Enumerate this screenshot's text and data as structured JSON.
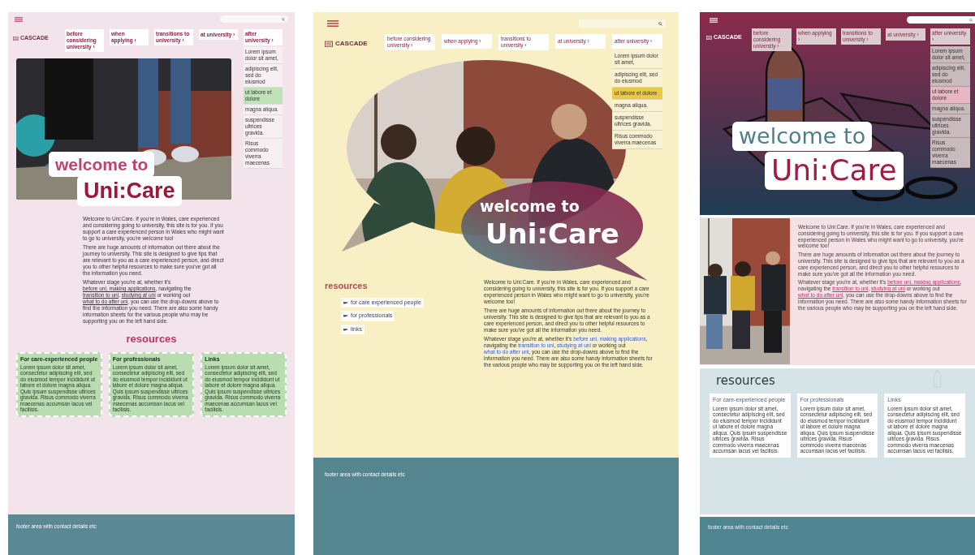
{
  "panels": [
    {
      "kind": "pink",
      "logo": "CASCADE",
      "nav": [
        "before considering university ›",
        "when applying ›",
        "transitions to university ›",
        "at university ›",
        "after university ›"
      ],
      "dropdown": [
        {
          "label": "Lorem ipsum dolor sit amet,",
          "selected": false
        },
        {
          "label": "adipiscing elit, sed do eiusmod",
          "selected": false
        },
        {
          "label": "ut labore et dolore",
          "selected": true
        },
        {
          "label": "magna aliqua.",
          "selected": false
        },
        {
          "label": "suspendisse ultrices gravida.",
          "selected": false
        },
        {
          "label": "Risus commodo viverra maecenas",
          "selected": false
        }
      ],
      "hero": {
        "line1": "welcome to",
        "line2": "Uni:Care"
      },
      "paragraphs": [
        [
          {
            "text": "Welcome to Uni:Care. If you're in Wales, care experienced and considering going to university, this site is for you. If you support a care experienced person in Wales who might want to go to university, you're welcome too!"
          }
        ],
        [
          {
            "text": "There are huge amounts of information out there about the journey to university. This site is designed to give tips that are relevant to you as a care experienced person, and direct you to other helpful resources to make sure you've got all the information you need."
          }
        ],
        [
          {
            "text": "Whatever stage you're at, whether it's "
          },
          {
            "text": "before uni, making applications",
            "link": true
          },
          {
            "text": ", navigating the "
          },
          {
            "text": "transition to uni",
            "link": true
          },
          {
            "text": ", "
          },
          {
            "text": "studying at uni",
            "link": true
          },
          {
            "text": " or working out "
          },
          {
            "text": "what to do after uni",
            "link": true
          },
          {
            "text": ", you can use the drop-downs above to find the information you need. There are also some handy information sheets for the various people who may be supporting you on the left hand side."
          }
        ]
      ],
      "resources": {
        "heading": "resources",
        "items": [
          {
            "title": "For care-experienced people",
            "body": "Lorem ipsum dolor sit amet, consectetur adipiscing elit, sed do eiusmod tempor incididunt ut labore et dolore magna aliqua. Quis ipsum suspendisse ultrices gravida. Risus commodo viverra maecenas accumsan lacus vel facilisis."
          },
          {
            "title": "For professionals",
            "body": "Lorem ipsum dolor sit amet, consectetur adipiscing elit, sed do eiusmod tempor incididunt ut labore et dolore magna aliqua. Quis ipsum suspendisse ultrices gravida. Risus commodo viverra maecenas accumsan lacus vel facilisis."
          },
          {
            "title": "Links",
            "body": "Lorem ipsum dolor sit amet, consectetur adipiscing elit, sed do eiusmod tempor incididunt ut labore et dolore magna aliqua. Quis ipsum suspendisse ultrices gravida. Risus commodo viverra maecenas accumsan lacus vel facilisis."
          }
        ]
      },
      "footer": "footer area with contact details etc"
    },
    {
      "kind": "cream",
      "logo": "CASCADE",
      "nav": [
        "before considering university ›",
        "when applying ›",
        "transitions to university ›",
        "at university ›",
        "after university ›"
      ],
      "dropdown": [
        {
          "label": "Lorem ipsum dolor sit amet,",
          "selected": false
        },
        {
          "label": "adipiscing elit, sed do eiusmod",
          "selected": false
        },
        {
          "label": "ut labore et dolore",
          "selected": true
        },
        {
          "label": "magna aliqua.",
          "selected": false
        },
        {
          "label": "suspendisse ultrices gravida.",
          "selected": false
        },
        {
          "label": "Risus commodo viverra maecenas",
          "selected": false
        }
      ],
      "hero": {
        "line1": "welcome to",
        "line2": "Uni:Care"
      },
      "resources": {
        "heading": "resources",
        "items": [
          {
            "title": "for care experienced people"
          },
          {
            "title": "for professionals"
          },
          {
            "title": "links"
          }
        ]
      },
      "paragraphs": [
        [
          {
            "text": "Welcome to Uni:Care. If you're in Wales, care experienced and considering going to university, this site is for you. If you support a care experienced person in Wales who might want to go to university, you're welcome too!"
          }
        ],
        [
          {
            "text": "There are huge amounts of information out there about the journey to university. This site is designed to give tips that are relevant to you as a care experienced person, and direct you to other helpful resources to make sure you've got all the information you need."
          }
        ],
        [
          {
            "text": "Whatever stage you're at, whether it's "
          },
          {
            "text": "before uni, making applications",
            "link": true
          },
          {
            "text": ", navigating the "
          },
          {
            "text": "transition to uni",
            "link": true
          },
          {
            "text": ", "
          },
          {
            "text": "studying at uni",
            "link": true
          },
          {
            "text": " or working out "
          },
          {
            "text": "what to do after uni",
            "link": true
          },
          {
            "text": ", you can use the drop-downs above to find the information you need. There are also some handy information sheets for the various people who may be supporting you on the left hand side."
          }
        ]
      ],
      "footer": "footer area with contact details etc"
    },
    {
      "kind": "dark",
      "logo": "CASCADE",
      "nav": [
        "before considering university ›",
        "when applying ›",
        "transitions to university ›",
        "at university ›",
        "after university ›"
      ],
      "dropdown": [
        {
          "label": "Lorem ipsum dolor sit amet,",
          "selected": false
        },
        {
          "label": "adipiscing elit, sed do eiusmod",
          "selected": false
        },
        {
          "label": "ut labore et dolore",
          "selected": true
        },
        {
          "label": "magna aliqua.",
          "selected": false
        },
        {
          "label": "suspendisse ultrices gravida.",
          "selected": false
        },
        {
          "label": "Risus commodo viverra maecenas",
          "selected": false
        }
      ],
      "hero": {
        "line1": "welcome to",
        "line2": "Uni:Care"
      },
      "paragraphs": [
        [
          {
            "text": "Welcome to Uni:Care. If you're in Wales, care experienced and considering going to university, this site is for you. If you support a care experienced person in Wales who might want to go to university, you're welcome too!"
          }
        ],
        [
          {
            "text": "There are huge amounts of information out there about the journey to university. This site is designed to give tips that are relevant to you as a care experienced person, and direct you to other helpful resources to make sure you've got all the information you need."
          }
        ],
        [
          {
            "text": "Whatever stage you're at, whether it's "
          },
          {
            "text": "before uni, making applications",
            "link": true
          },
          {
            "text": ", navigating the "
          },
          {
            "text": "transition to uni",
            "link": true
          },
          {
            "text": ", "
          },
          {
            "text": "studying at uni",
            "link": true
          },
          {
            "text": " or working out "
          },
          {
            "text": "what to do after uni",
            "link": true
          },
          {
            "text": ", you can use the drop-downs above to find the information you need. There are also some handy information sheets for the various people who may be supporting you on the left hand side."
          }
        ]
      ],
      "resources": {
        "heading": "resources",
        "items": [
          {
            "title": "For care-experienced people",
            "body": "Lorem ipsum dolor sit amet, consectetur adipiscing elit, sed do eiusmod tempor incididunt ut labore et dolore magna aliqua. Quis ipsum suspendisse ultrices gravida. Risus commodo viverra maecenas accumsan lacus vel facilisis."
          },
          {
            "title": "For professionals",
            "body": "Lorem ipsum dolor sit amet, consectetur adipiscing elit, sed do eiusmod tempor incididunt ut labore et dolore magna aliqua. Quis ipsum suspendisse ultrices gravida. Risus commodo viverra maecenas accumsan lacus vel facilisis."
          },
          {
            "title": "Links",
            "body": "Lorem ipsum dolor sit amet, consectetur adipiscing elit, sed do eiusmod tempor incididunt ut labore et dolore magna aliqua. Quis ipsum suspendisse ultrices gravida. Risus commodo viverra maecenas accumsan lacus vel facilisis."
          }
        ]
      },
      "footer": "footer area with contact details etc"
    }
  ]
}
